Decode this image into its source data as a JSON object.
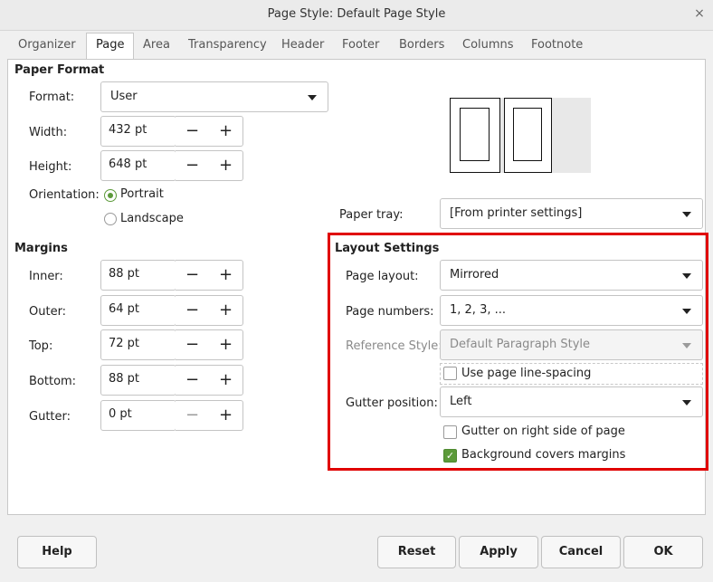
{
  "window": {
    "title": "Page Style: Default Page Style",
    "close": "×"
  },
  "tabs": [
    "Organizer",
    "Page",
    "Area",
    "Transparency",
    "Header",
    "Footer",
    "Borders",
    "Columns",
    "Footnote"
  ],
  "paper_format": {
    "section": "Paper Format",
    "format_label": "Format:",
    "format_value": "User",
    "width_label": "Width:",
    "width_value": "432 pt",
    "height_label": "Height:",
    "height_value": "648 pt",
    "orientation_label": "Orientation:",
    "portrait": "Portrait",
    "landscape": "Landscape",
    "orientation_selected": "Portrait"
  },
  "margins": {
    "section": "Margins",
    "inner_label": "Inner:",
    "inner_value": "88 pt",
    "outer_label": "Outer:",
    "outer_value": "64 pt",
    "top_label": "Top:",
    "top_value": "72 pt",
    "bottom_label": "Bottom:",
    "bottom_value": "88 pt",
    "gutter_label": "Gutter:",
    "gutter_value": "0 pt"
  },
  "paper_tray": {
    "label": "Paper tray:",
    "value": "[From printer settings]"
  },
  "layout": {
    "section": "Layout Settings",
    "page_layout_label": "Page layout:",
    "page_layout_value": "Mirrored",
    "page_numbers_label": "Page numbers:",
    "page_numbers_value": "1, 2, 3, ...",
    "reference_label": "Reference Style:",
    "reference_value": "Default Paragraph Style",
    "line_spacing_label": "Use page line-spacing",
    "line_spacing_checked": false,
    "gutter_pos_label": "Gutter position:",
    "gutter_pos_value": "Left",
    "gutter_right_label": "Gutter on right side of page",
    "gutter_right_checked": false,
    "bg_margins_label": "Background covers margins",
    "bg_margins_checked": true
  },
  "spin": {
    "minus": "−",
    "plus": "+"
  },
  "buttons": {
    "help": "Help",
    "reset": "Reset",
    "apply": "Apply",
    "cancel": "Cancel",
    "ok": "OK"
  },
  "colors": {
    "accent": "#5c9a3a",
    "highlight": "#e00000"
  }
}
